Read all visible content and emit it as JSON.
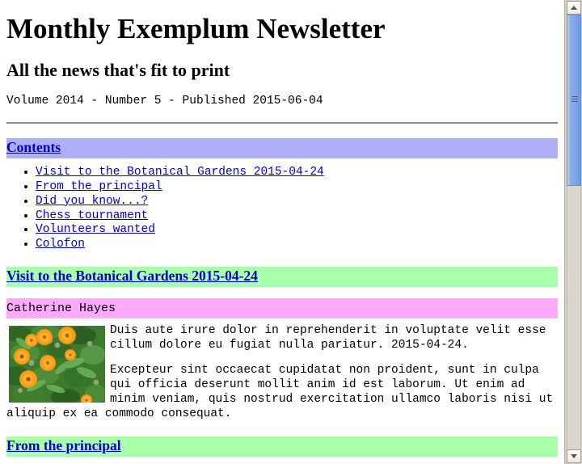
{
  "masthead": {
    "title": "Monthly Exemplum Newsletter",
    "subtitle": "All the news that's fit to print",
    "meta": "Volume 2014 - Number 5 - Published 2015-06-04"
  },
  "contents": {
    "heading": "Contents",
    "items": [
      {
        "label": "Visit to the Botanical Gardens 2015-04-24"
      },
      {
        "label": "From the principal"
      },
      {
        "label": "Did you know...?"
      },
      {
        "label": "Chess tournament"
      },
      {
        "label": "Volunteers wanted"
      },
      {
        "label": "Colofon"
      }
    ]
  },
  "articles": [
    {
      "heading": "Visit to the Botanical Gardens 2015-04-24",
      "author": "Catherine Hayes",
      "image_alt": "orange calendula flowers among green foliage",
      "paragraphs": [
        "Duis aute irure dolor in reprehenderit in voluptate velit esse cillum dolore eu fugiat nulla pariatur. 2015-04-24.",
        "Excepteur sint occaecat cupidatat non proident, sunt in culpa qui officia deserunt mollit anim id est laborum. Ut enim ad minim veniam, quis nostrud exercitation ullamco laboris nisi ut aliquip ex ea commodo consequat."
      ]
    },
    {
      "heading": "From the principal"
    }
  ],
  "scrollbar": {
    "up_label": "scroll up",
    "down_label": "scroll down",
    "thumb_label": "vertical scroll thumb"
  },
  "colors": {
    "contents_bar": "#aeaef7",
    "article_bar": "#aaffaa",
    "author_bar": "#ffaaff",
    "link": "#0000cc",
    "text": "#000000",
    "page_background": "#ffffff",
    "scrollbar_thumb": "#7ba3e6",
    "scrollbar_track": "#d9d5cd"
  }
}
